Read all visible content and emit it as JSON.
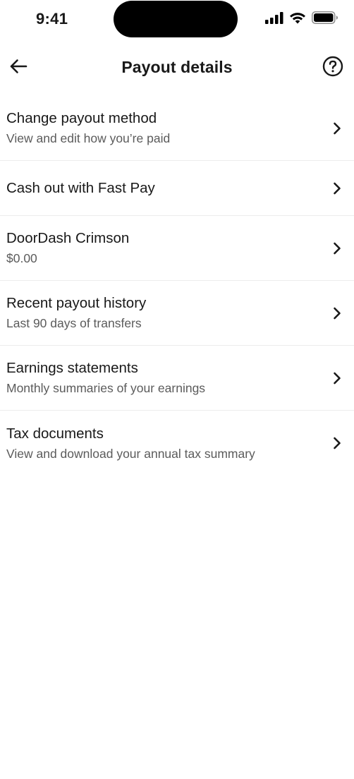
{
  "status_bar": {
    "time": "9:41"
  },
  "header": {
    "title": "Payout details"
  },
  "menu": {
    "items": [
      {
        "title": "Change payout method",
        "subtitle": "View and edit how you’re paid"
      },
      {
        "title": "Cash out with Fast Pay",
        "subtitle": ""
      },
      {
        "title": "DoorDash Crimson",
        "subtitle": "$0.00"
      },
      {
        "title": "Recent payout history",
        "subtitle": "Last 90 days of transfers"
      },
      {
        "title": "Earnings statements",
        "subtitle": "Monthly summaries of your earnings"
      },
      {
        "title": "Tax documents",
        "subtitle": "View and download your annual tax summary"
      }
    ]
  }
}
